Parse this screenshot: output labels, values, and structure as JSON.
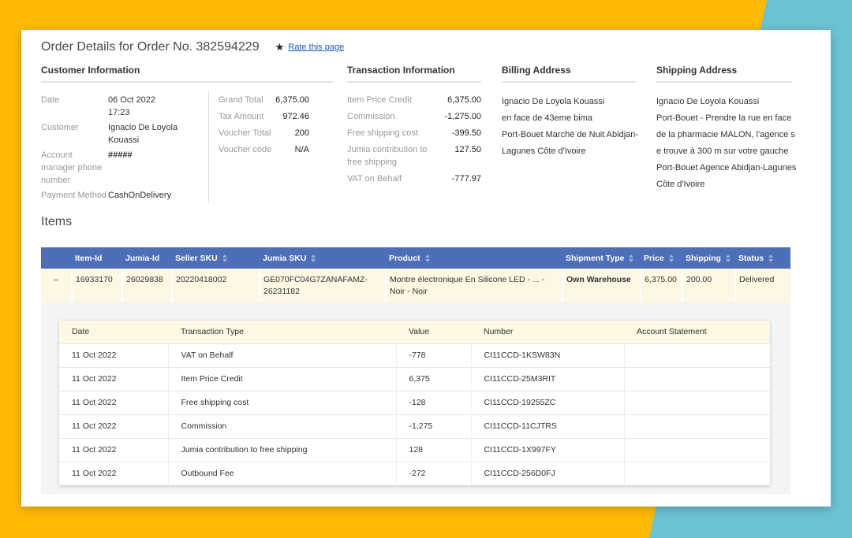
{
  "colors": {
    "background_yellow": "#feba05",
    "accent_cyan": "#6cc2d4",
    "table_header_blue": "#4d6eb9",
    "row_cream": "#fcf8e3",
    "link_blue": "#1a55c8"
  },
  "header": {
    "title": "Order Details for Order No. 382594229",
    "rate_link": "Rate this page",
    "star_icon": "★"
  },
  "customer_information": {
    "heading": "Customer Information",
    "fields": [
      {
        "label": "Date",
        "value": "06 Oct 2022 17:23"
      },
      {
        "label": "Customer",
        "value": "Ignacio De Loyola Kouassi"
      },
      {
        "label": "Account manager phone number",
        "value": "#####"
      },
      {
        "label": "Payment Method",
        "value": "CashOnDelivery"
      }
    ],
    "totals": [
      {
        "label": "Grand Total",
        "value": "6,375.00"
      },
      {
        "label": "Tax Amount",
        "value": "972.46"
      },
      {
        "label": "Voucher Total",
        "value": "200"
      },
      {
        "label": "Voucher code",
        "value": "N/A"
      }
    ]
  },
  "transaction_information": {
    "heading": "Transaction Information",
    "rows": [
      {
        "label": "Item Price Credit",
        "value": "6,375.00"
      },
      {
        "label": "Commission",
        "value": "-1,275.00"
      },
      {
        "label": "Free shipping cost",
        "value": "-399.50"
      },
      {
        "label": "Jumia contribution to free shipping",
        "value": "127.50"
      },
      {
        "label": "VAT on Behalf",
        "value": "-777.97"
      }
    ]
  },
  "billing_address": {
    "heading": "Billing Address",
    "lines": [
      "Ignacio De Loyola Kouassi",
      "en face de 43eme bima",
      "Port-Bouet Marché de Nuit Abidjan-",
      "Lagunes Côte d'Ivoire"
    ]
  },
  "shipping_address": {
    "heading": "Shipping Address",
    "lines": [
      "Ignacio De Loyola Kouassi",
      "Port-Bouet - Prendre la rue en face",
      "de la pharmacie MALON, l'agence s",
      "e trouve à 300 m sur votre gauche",
      "Port-Bouet Agence Abidjan-Lagunes",
      "Côte d'Ivoire"
    ]
  },
  "items": {
    "heading": "Items",
    "expand_symbol": "–",
    "columns": {
      "item_id": "Item-Id",
      "jumia_id": "Jumia-Id",
      "seller_sku": "Seller SKU",
      "jumia_sku": "Jumia SKU",
      "product": "Product",
      "shipment_type": "Shipment Type",
      "price": "Price",
      "shipping": "Shipping",
      "status": "Status"
    },
    "row": {
      "item_id": "16933170",
      "jumia_id": "26029838",
      "seller_sku": "20220418002",
      "jumia_sku": "GE070FC04G7ZANAFAMZ-26231182",
      "product": "Montre électronique En Silicone LED - ... - Noir - Noir",
      "shipment_type": "Own Warehouse",
      "price": "6,375.00",
      "shipping": "200.00",
      "status": "Delivered"
    }
  },
  "transactions": {
    "columns": {
      "date": "Date",
      "type": "Transaction Type",
      "value": "Value",
      "number": "Number",
      "statement": "Account Statement"
    },
    "rows": [
      {
        "date": "11 Oct 2022",
        "type": "VAT on Behalf",
        "value": "-778",
        "number": "CI11CCD-1KSW83N",
        "statement": ""
      },
      {
        "date": "11 Oct 2022",
        "type": "Item Price Credit",
        "value": "6,375",
        "number": "CI11CCD-25M3RIT",
        "statement": ""
      },
      {
        "date": "11 Oct 2022",
        "type": "Free shipping cost",
        "value": "-128",
        "number": "CI11CCD-19255ZC",
        "statement": ""
      },
      {
        "date": "11 Oct 2022",
        "type": "Commission",
        "value": "-1,275",
        "number": "CI11CCD-11CJTRS",
        "statement": ""
      },
      {
        "date": "11 Oct 2022",
        "type": "Jumia contribution to free shipping",
        "value": "128",
        "number": "CI11CCD-1X997FY",
        "statement": ""
      },
      {
        "date": "11 Oct 2022",
        "type": "Outbound Fee",
        "value": "-272",
        "number": "CI11CCD-256D0FJ",
        "statement": ""
      }
    ]
  }
}
